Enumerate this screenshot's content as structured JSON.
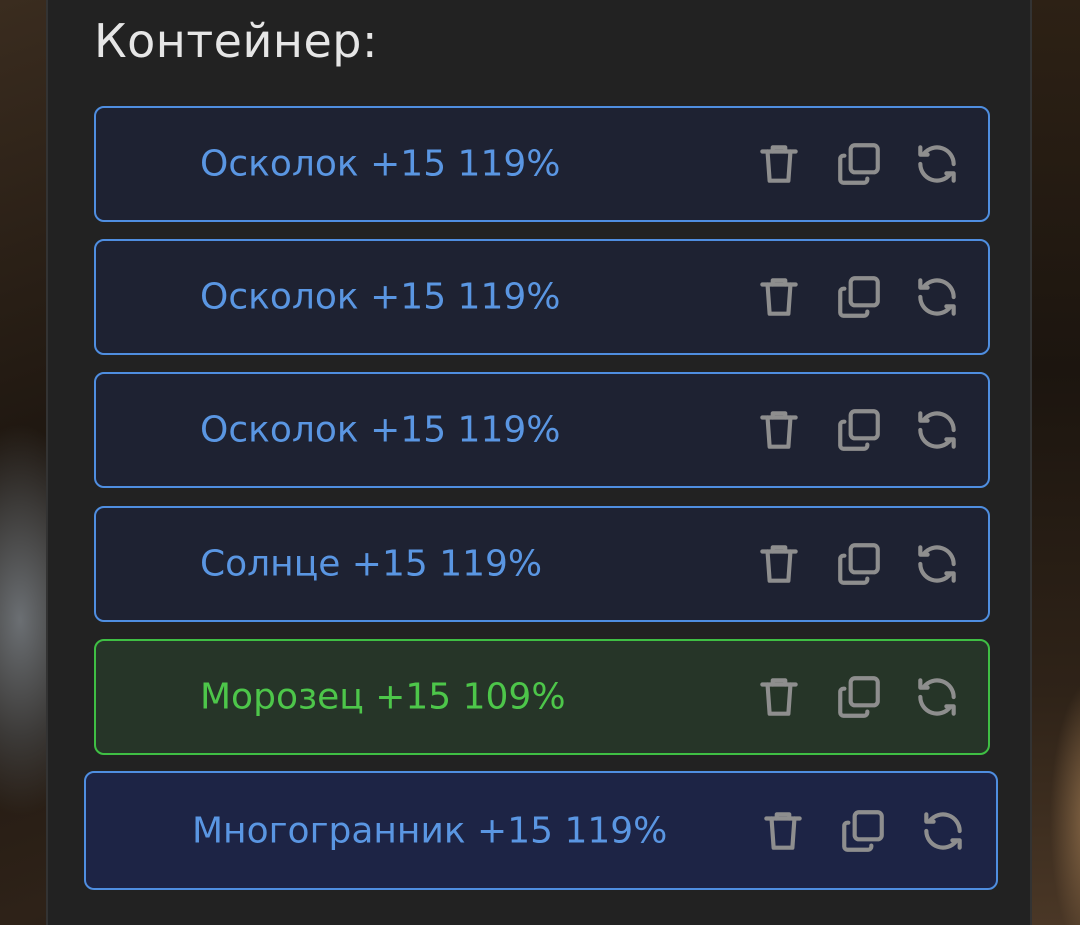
{
  "container": {
    "title": "Контейнер:"
  },
  "items": [
    {
      "label": "Осколок +15 119%",
      "state": "normal"
    },
    {
      "label": "Осколок +15 119%",
      "state": "normal"
    },
    {
      "label": "Осколок +15 119%",
      "state": "normal"
    },
    {
      "label": "Солнце +15 119%",
      "state": "normal"
    },
    {
      "label": "Морозец +15 109%",
      "state": "green"
    },
    {
      "label": "Многогранник +15 119%",
      "state": "active"
    }
  ],
  "icons": {
    "delete": "trash-icon",
    "copy": "copy-icon",
    "replace": "refresh-icon"
  },
  "colors": {
    "item_border": "#4f8ee0",
    "item_text": "#5a96e2",
    "green_border": "#3fbf44",
    "green_text": "#4dc64a",
    "icon": "#8e8e8e",
    "panel_bg": "#222222"
  }
}
